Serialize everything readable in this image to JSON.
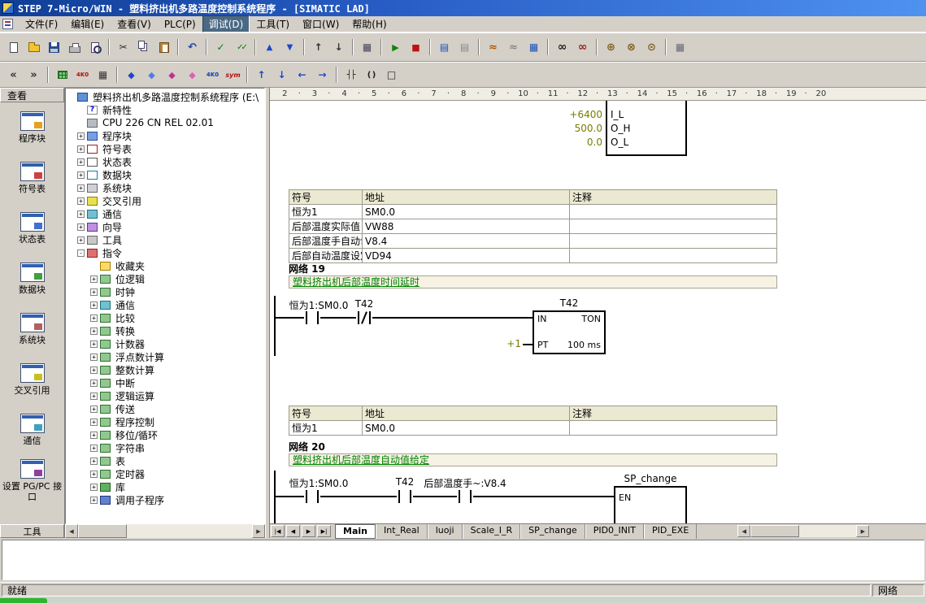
{
  "window": {
    "title": "STEP 7-Micro/WIN - 塑料挤出机多路温度控制系统程序 - [SIMATIC LAD]"
  },
  "menu": {
    "items": [
      {
        "label": "文件(F)",
        "selected": "false"
      },
      {
        "label": "编辑(E)",
        "selected": "false"
      },
      {
        "label": "查看(V)",
        "selected": "false"
      },
      {
        "label": "PLC(P)",
        "selected": "false"
      },
      {
        "label": "调试(D)",
        "selected": "true"
      },
      {
        "label": "工具(T)",
        "selected": "false"
      },
      {
        "label": "窗口(W)",
        "selected": "false"
      },
      {
        "label": "帮助(H)",
        "selected": "false"
      }
    ]
  },
  "toolbar_main": {
    "items": [
      {
        "kind": "btn",
        "name": "new-file-button",
        "icon": "new-icon",
        "inter": "true"
      },
      {
        "kind": "btn",
        "name": "open-file-button",
        "icon": "open-icon",
        "inter": "true"
      },
      {
        "kind": "btn",
        "name": "save-button",
        "icon": "save-icon",
        "inter": "true"
      },
      {
        "kind": "btn",
        "name": "print-button",
        "icon": "print-icon",
        "inter": "true"
      },
      {
        "kind": "btn",
        "name": "print-preview-button",
        "icon": "preview-icon",
        "inter": "true"
      },
      {
        "kind": "sep",
        "name": "toolbar-separator",
        "icon": "",
        "inter": "false"
      },
      {
        "kind": "btn",
        "name": "cut-button",
        "icon": "cut-icon",
        "inter": "true"
      },
      {
        "kind": "btn",
        "name": "copy-button",
        "icon": "copy-icon",
        "inter": "true"
      },
      {
        "kind": "btn",
        "name": "paste-button",
        "icon": "paste-icon",
        "inter": "true"
      },
      {
        "kind": "sep",
        "name": "toolbar-separator",
        "icon": "",
        "inter": "false"
      },
      {
        "kind": "btn",
        "name": "undo-button",
        "icon": "undo-icon",
        "inter": "true"
      },
      {
        "kind": "sep",
        "name": "toolbar-separator",
        "icon": "",
        "inter": "false"
      },
      {
        "kind": "btn",
        "name": "compile-button",
        "icon": "compile-icon",
        "inter": "true"
      },
      {
        "kind": "btn",
        "name": "compile-all-button",
        "icon": "compile-all-icon",
        "inter": "true"
      },
      {
        "kind": "sep",
        "name": "toolbar-separator",
        "icon": "",
        "inter": "false"
      },
      {
        "kind": "btn",
        "name": "upload-button",
        "icon": "upload-icon",
        "inter": "true"
      },
      {
        "kind": "btn",
        "name": "download-button",
        "icon": "download-icon",
        "inter": "true"
      },
      {
        "kind": "sep",
        "name": "toolbar-separator",
        "icon": "",
        "inter": "false"
      },
      {
        "kind": "btn",
        "name": "sort-ascending-button",
        "icon": "sort-asc-icon",
        "inter": "true"
      },
      {
        "kind": "btn",
        "name": "sort-descending-button",
        "icon": "sort-desc-icon",
        "inter": "true"
      },
      {
        "kind": "sep",
        "name": "toolbar-separator",
        "icon": "",
        "inter": "false"
      },
      {
        "kind": "btn",
        "name": "options-button",
        "icon": "options-icon",
        "inter": "true"
      },
      {
        "kind": "sep",
        "name": "toolbar-separator",
        "icon": "",
        "inter": "false"
      },
      {
        "kind": "btn",
        "name": "run-button",
        "icon": "run-icon",
        "inter": "true"
      },
      {
        "kind": "btn",
        "name": "stop-button",
        "icon": "stop-icon",
        "inter": "true"
      },
      {
        "kind": "sep",
        "name": "toolbar-separator",
        "icon": "",
        "inter": "false"
      },
      {
        "kind": "btn",
        "name": "program-status-button",
        "icon": "pstatus-icon",
        "inter": "true"
      },
      {
        "kind": "btn",
        "name": "pause-program-status-button",
        "icon": "pstatus-off-icon",
        "inter": "true"
      },
      {
        "kind": "sep",
        "name": "toolbar-separator",
        "icon": "",
        "inter": "false"
      },
      {
        "kind": "btn",
        "name": "chart-status-button",
        "icon": "chart-icon",
        "inter": "true"
      },
      {
        "kind": "btn",
        "name": "pause-chart-status-button",
        "icon": "chart-off-icon",
        "inter": "true"
      },
      {
        "kind": "btn",
        "name": "status-table-button",
        "icon": "stable-icon",
        "inter": "true"
      },
      {
        "kind": "sep",
        "name": "toolbar-separator",
        "icon": "",
        "inter": "false"
      },
      {
        "kind": "btn",
        "name": "program-monitor-button",
        "icon": "glasses-icon",
        "inter": "true"
      },
      {
        "kind": "btn",
        "name": "pause-monitor-button",
        "icon": "glasses-off-icon",
        "inter": "true"
      },
      {
        "kind": "sep",
        "name": "toolbar-separator",
        "icon": "",
        "inter": "false"
      },
      {
        "kind": "btn",
        "name": "force-button",
        "icon": "force-icon",
        "inter": "true"
      },
      {
        "kind": "btn",
        "name": "unforce-button",
        "icon": "unforce-icon",
        "inter": "true"
      },
      {
        "kind": "btn",
        "name": "read-forced-button",
        "icon": "readforce-icon",
        "inter": "true"
      },
      {
        "kind": "sep",
        "name": "toolbar-separator",
        "icon": "",
        "inter": "false"
      },
      {
        "kind": "btn",
        "name": "table-grid-button",
        "icon": "gridcells-icon",
        "inter": "true"
      }
    ]
  },
  "toolbar_ladder": {
    "items": [
      {
        "kind": "btn",
        "name": "prev-bookmark-button",
        "icon": "bm-prev-icon",
        "inter": "true"
      },
      {
        "kind": "btn",
        "name": "next-bookmark-button",
        "icon": "bm-next-icon",
        "inter": "true"
      },
      {
        "kind": "sep",
        "name": "toolbar-separator",
        "icon": "",
        "inter": "false"
      },
      {
        "kind": "btn",
        "name": "apply-symbols-button",
        "icon": "apply-sym-icon",
        "inter": "true"
      },
      {
        "kind": "btn",
        "name": "constant-descriptor-button",
        "icon": "addr-red-icon",
        "inter": "true"
      },
      {
        "kind": "btn",
        "name": "symbol-info-table-button",
        "icon": "infotable-icon",
        "inter": "true"
      },
      {
        "kind": "sep",
        "name": "toolbar-separator",
        "icon": "",
        "inter": "false"
      },
      {
        "kind": "btn",
        "name": "insert-network-button",
        "icon": "net-ins-icon",
        "inter": "true"
      },
      {
        "kind": "btn",
        "name": "delete-network-button",
        "icon": "net-del-icon",
        "inter": "true"
      },
      {
        "kind": "btn",
        "name": "insert-row-button",
        "icon": "row-ins-icon",
        "inter": "true"
      },
      {
        "kind": "btn",
        "name": "delete-row-button",
        "icon": "row-del-icon",
        "inter": "true"
      },
      {
        "kind": "btn",
        "name": "address-view-button",
        "icon": "addr-blue-icon",
        "inter": "true"
      },
      {
        "kind": "btn",
        "name": "symbol-view-toggle-button",
        "icon": "sym-toggle-icon",
        "inter": "true"
      },
      {
        "kind": "sep",
        "name": "toolbar-separator",
        "icon": "",
        "inter": "false"
      },
      {
        "kind": "btn",
        "name": "line-up-button",
        "icon": "line-up-icon",
        "inter": "true"
      },
      {
        "kind": "btn",
        "name": "line-down-button",
        "icon": "line-down-icon",
        "inter": "true"
      },
      {
        "kind": "btn",
        "name": "line-left-button",
        "icon": "line-left-icon",
        "inter": "true"
      },
      {
        "kind": "btn",
        "name": "line-right-button",
        "icon": "line-right-icon",
        "inter": "true"
      },
      {
        "kind": "sep",
        "name": "toolbar-separator",
        "icon": "",
        "inter": "false"
      },
      {
        "kind": "btn",
        "name": "insert-contact-button",
        "icon": "contact-icon",
        "inter": "true"
      },
      {
        "kind": "btn",
        "name": "insert-coil-button",
        "icon": "coil-icon",
        "inter": "true"
      },
      {
        "kind": "btn",
        "name": "insert-box-button",
        "icon": "boxinstr-icon",
        "inter": "true"
      }
    ]
  },
  "viewbar": {
    "title": "查看",
    "bottom_title": "工具",
    "items": [
      {
        "label": "程序块",
        "icon": "program-block-icon"
      },
      {
        "label": "符号表",
        "icon": "symbol-table-icon"
      },
      {
        "label": "状态表",
        "icon": "status-chart-icon"
      },
      {
        "label": "数据块",
        "icon": "data-block-icon"
      },
      {
        "label": "系统块",
        "icon": "system-block-icon"
      },
      {
        "label": "交叉引用",
        "icon": "cross-reference-icon"
      },
      {
        "label": "通信",
        "icon": "communications-icon"
      },
      {
        "label": "设置 PG/PC 接口",
        "icon": "set-pg-pc-icon"
      }
    ]
  },
  "tree": {
    "items": [
      {
        "label": "塑料挤出机多路温度控制系统程序 (E:\\",
        "level": 0,
        "expander": "",
        "icon": "project-icon"
      },
      {
        "label": "新特性",
        "level": 1,
        "expander": "",
        "icon": "whats-new-icon"
      },
      {
        "label": "CPU 226 CN REL 02.01",
        "level": 1,
        "expander": "",
        "icon": "cpu-icon"
      },
      {
        "label": "程序块",
        "level": 1,
        "expander": "+",
        "icon": "program-block-icon"
      },
      {
        "label": "符号表",
        "level": 1,
        "expander": "+",
        "icon": "symbol-table-icon"
      },
      {
        "label": "状态表",
        "level": 1,
        "expander": "+",
        "icon": "status-chart-icon"
      },
      {
        "label": "数据块",
        "level": 1,
        "expander": "+",
        "icon": "data-block-icon"
      },
      {
        "label": "系统块",
        "level": 1,
        "expander": "+",
        "icon": "system-block-icon"
      },
      {
        "label": "交叉引用",
        "level": 1,
        "expander": "+",
        "icon": "cross-reference-icon"
      },
      {
        "label": "通信",
        "level": 1,
        "expander": "+",
        "icon": "communications-icon"
      },
      {
        "label": "向导",
        "level": 1,
        "expander": "+",
        "icon": "wizard-icon"
      },
      {
        "label": "工具",
        "level": 1,
        "expander": "+",
        "icon": "tools-icon"
      },
      {
        "label": "指令",
        "level": 1,
        "expander": "-",
        "icon": "instructions-icon"
      },
      {
        "label": "收藏夹",
        "level": 2,
        "expander": "",
        "icon": "favorites-icon"
      },
      {
        "label": "位逻辑",
        "level": 2,
        "expander": "+",
        "icon": "bit-logic-icon"
      },
      {
        "label": "时钟",
        "level": 2,
        "expander": "+",
        "icon": "clock-icon"
      },
      {
        "label": "通信",
        "level": 2,
        "expander": "+",
        "icon": "communications-icon"
      },
      {
        "label": "比较",
        "level": 2,
        "expander": "+",
        "icon": "compare-icon"
      },
      {
        "label": "转换",
        "level": 2,
        "expander": "+",
        "icon": "convert-icon"
      },
      {
        "label": "计数器",
        "level": 2,
        "expander": "+",
        "icon": "counter-icon"
      },
      {
        "label": "浮点数计算",
        "level": 2,
        "expander": "+",
        "icon": "float-math-icon"
      },
      {
        "label": "整数计算",
        "level": 2,
        "expander": "+",
        "icon": "int-math-icon"
      },
      {
        "label": "中断",
        "level": 2,
        "expander": "+",
        "icon": "interrupt-icon"
      },
      {
        "label": "逻辑运算",
        "level": 2,
        "expander": "+",
        "icon": "logic-icon"
      },
      {
        "label": "传送",
        "level": 2,
        "expander": "+",
        "icon": "move-icon"
      },
      {
        "label": "程序控制",
        "level": 2,
        "expander": "+",
        "icon": "program-control-icon"
      },
      {
        "label": "移位/循环",
        "level": 2,
        "expander": "+",
        "icon": "shift-rotate-icon"
      },
      {
        "label": "字符串",
        "level": 2,
        "expander": "+",
        "icon": "string-icon"
      },
      {
        "label": "表",
        "level": 2,
        "expander": "+",
        "icon": "table-icon"
      },
      {
        "label": "定时器",
        "level": 2,
        "expander": "+",
        "icon": "timer-icon"
      },
      {
        "label": "库",
        "level": 2,
        "expander": "+",
        "icon": "library-icon"
      },
      {
        "label": "调用子程序",
        "level": 2,
        "expander": "+",
        "icon": "call-subroutine-icon"
      }
    ]
  },
  "editor": {
    "ruler_ticks": [
      "2",
      "3",
      "4",
      "5",
      "6",
      "7",
      "8",
      "9",
      "10",
      "11",
      "12",
      "13",
      "14",
      "15",
      "16",
      "17",
      "18",
      "19",
      "20"
    ],
    "scale_block": {
      "rows": [
        {
          "value": "+6400",
          "port": "I_L"
        },
        {
          "value": "500.0",
          "port": "O_H"
        },
        {
          "value": "0.0",
          "port": "O_L"
        }
      ]
    },
    "symbol_table_1": {
      "headers": [
        "符号",
        "地址",
        "注释"
      ],
      "rows": [
        {
          "sym": "恒为1",
          "addr": "SM0.0",
          "note": ""
        },
        {
          "sym": "后部温度实际值",
          "addr": "VW88",
          "note": ""
        },
        {
          "sym": "后部温度手自动切换",
          "addr": "V8.4",
          "note": ""
        },
        {
          "sym": "后部自动温度设定值",
          "addr": "VD94",
          "note": ""
        }
      ]
    },
    "network_19": {
      "label": "网络 19",
      "comment": "塑料挤出机后部温度时间延时",
      "contacts": [
        {
          "label": "恒为1:SM0.0",
          "type": "NO"
        },
        {
          "label": "T42",
          "type": "NC"
        }
      ],
      "timer": {
        "name": "T42",
        "type": "TON",
        "in_label": "IN",
        "pt_label": "PT",
        "pt_operand": "+1",
        "time_base": "100 ms"
      }
    },
    "symbol_table_2": {
      "headers": [
        "符号",
        "地址",
        "注释"
      ],
      "rows": [
        {
          "sym": "恒为1",
          "addr": "SM0.0",
          "note": ""
        }
      ]
    },
    "network_20": {
      "label": "网络 20",
      "comment": "塑料挤出机后部温度自动值给定",
      "contacts": [
        {
          "label": "恒为1:SM0.0",
          "type": "NO"
        },
        {
          "label": "T42",
          "type": "NO"
        },
        {
          "label": "后部温度手~:V8.4",
          "type": "NO"
        }
      ],
      "block": {
        "name": "SP_change",
        "en_label": "EN"
      }
    },
    "tabs": {
      "nav": [
        {
          "name": "first-tab-button",
          "glyph": "|◀"
        },
        {
          "name": "prev-tab-button",
          "glyph": "◀"
        },
        {
          "name": "next-tab-button",
          "glyph": "▶"
        },
        {
          "name": "last-tab-button",
          "glyph": "▶|"
        }
      ],
      "items": [
        {
          "label": "Main",
          "active": "true"
        },
        {
          "label": "Int_Real",
          "active": "false"
        },
        {
          "label": "luoji",
          "active": "false"
        },
        {
          "label": "Scale_I_R",
          "active": "false"
        },
        {
          "label": "SP_change",
          "active": "false"
        },
        {
          "label": "PID0_INIT",
          "active": "false"
        },
        {
          "label": "PID_EXE",
          "active": "false"
        }
      ]
    },
    "scrollbar": {
      "left_arrow": "◀",
      "right_arrow": "▶"
    }
  },
  "tree_scrollbar": {
    "left_arrow": "◀",
    "right_arrow": "▶"
  },
  "statusbar": {
    "ready": "就绪",
    "network_label": "网络"
  },
  "colors": {
    "titlebar_blue": "#2A5FC8",
    "comment_green": "#008000",
    "constant_olive": "#7B7B00",
    "network_comment_bg": "#F6F3E4",
    "table_header_bg": "#ECE9D2"
  }
}
